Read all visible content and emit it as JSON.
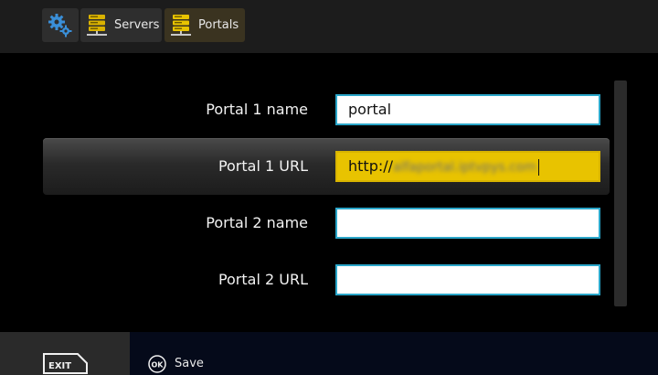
{
  "toolbar": {
    "settings_icon": "gears-icon",
    "servers_label": "Servers",
    "portals_label": "Portals",
    "accent_color": "#e8c300",
    "field_border_color": "#2aa6c9"
  },
  "form": {
    "rows": [
      {
        "label": "Portal 1 name",
        "value": "portal"
      },
      {
        "label": "Portal 1 URL",
        "value": "http://",
        "value_obscured": "alfaportal.iptvpys.com"
      },
      {
        "label": "Portal 2 name",
        "value": ""
      },
      {
        "label": "Portal 2 URL",
        "value": ""
      }
    ],
    "selected_row": "Portal 1 URL"
  },
  "footer": {
    "exit_label": "EXIT",
    "ok_label": "OK",
    "save_label": "Save"
  }
}
